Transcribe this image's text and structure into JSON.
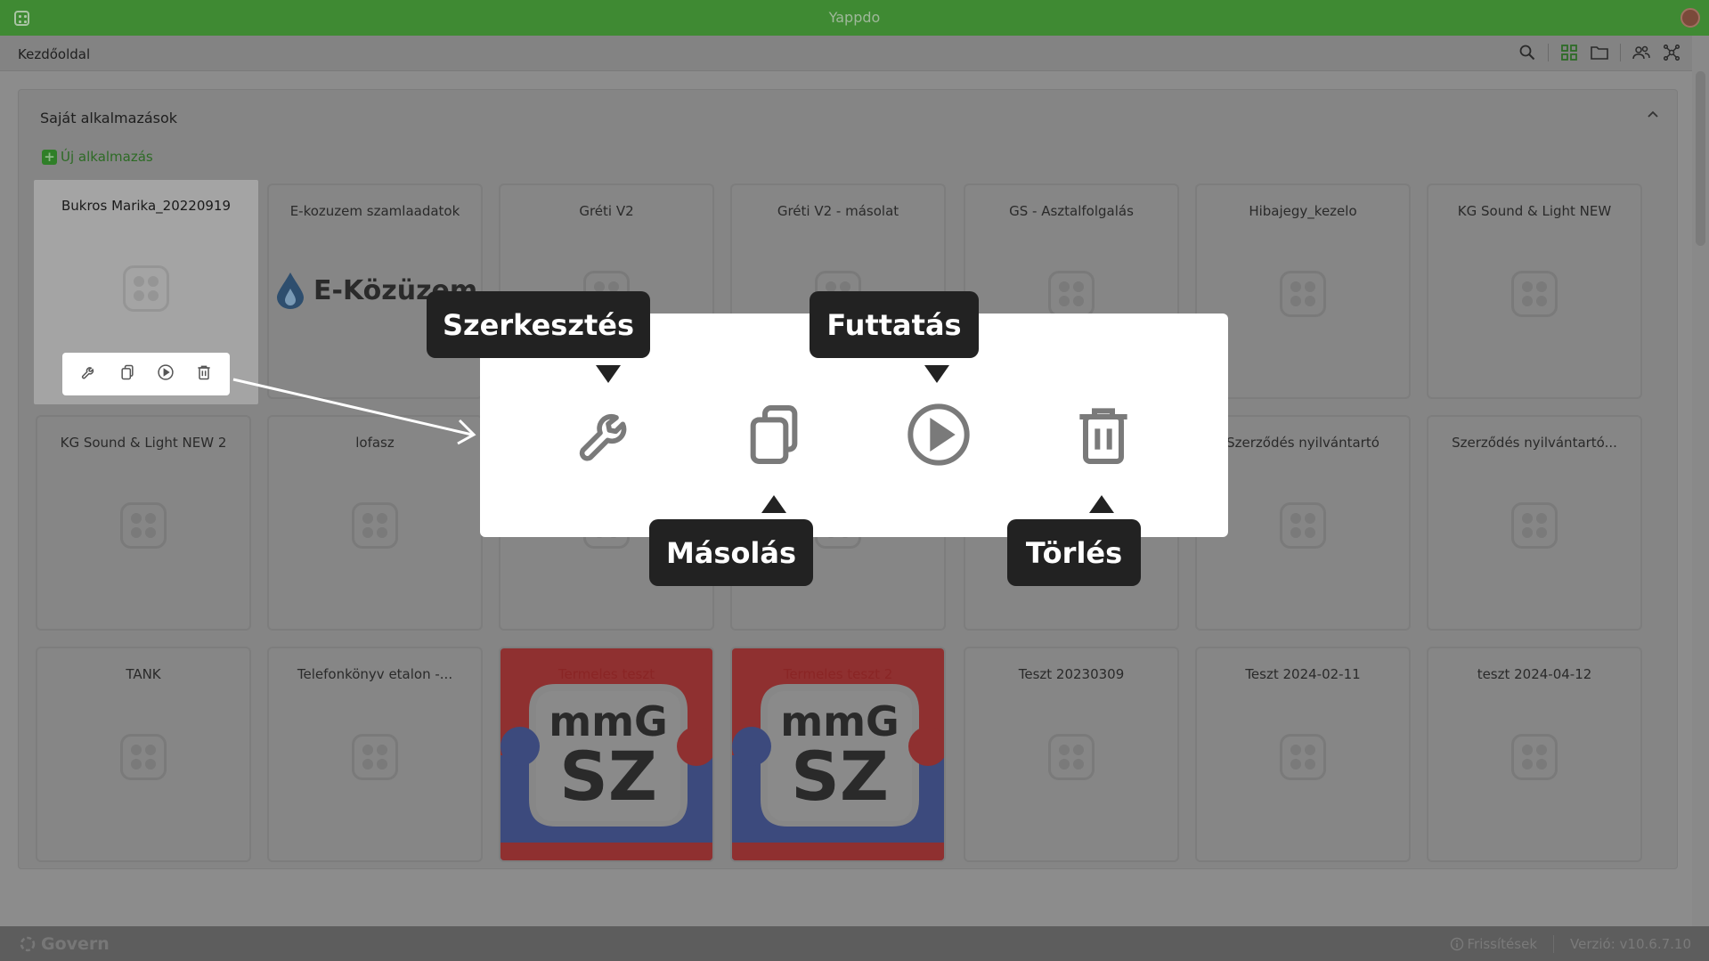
{
  "titlebar": {
    "app_title": "Yappdo"
  },
  "toolbar": {
    "breadcrumb": "Kezdőoldal"
  },
  "panel": {
    "title": "Saját alkalmazások",
    "new_app_label": "Új alkalmazás"
  },
  "apps": [
    {
      "name": "Bukros Marika_20220919"
    },
    {
      "name": "E-kozuzem szamlaadatok",
      "logo_text": "E-Közüzem"
    },
    {
      "name": "Gréti V2"
    },
    {
      "name": "Gréti V2 - másolat"
    },
    {
      "name": "GS - Asztalfolgalás"
    },
    {
      "name": "Hibajegy_kezelo"
    },
    {
      "name": "KG Sound & Light NEW"
    },
    {
      "name": "KG Sound & Light NEW 2"
    },
    {
      "name": "lofasz"
    },
    {
      "name": ""
    },
    {
      "name": ""
    },
    {
      "name": ""
    },
    {
      "name": "Szerződés nyilvántartó"
    },
    {
      "name": "Szerződés nyilvántartó..."
    },
    {
      "name": "TANK"
    },
    {
      "name": "Telefonkönyv etalon -..."
    },
    {
      "name": "Termeles teszt",
      "logo_line1": "mmG",
      "logo_line2": "SZ"
    },
    {
      "name": "Termeles teszt 2",
      "logo_line1": "mmG",
      "logo_line2": "SZ"
    },
    {
      "name": "Teszt 20230309"
    },
    {
      "name": "Teszt 2024-02-11"
    },
    {
      "name": "teszt 2024-04-12"
    }
  ],
  "tooltips": {
    "edit": "Szerkesztés",
    "run": "Futtatás",
    "copy": "Másolás",
    "delete": "Törlés"
  },
  "footer": {
    "brand": "Govern",
    "updates": "Frissítések",
    "version": "Verzió: v10.6.7.10"
  },
  "colors": {
    "titlebar": "#3f8a33",
    "tooltip_bg": "#222222",
    "icon_gray": "#7a7a7a"
  }
}
